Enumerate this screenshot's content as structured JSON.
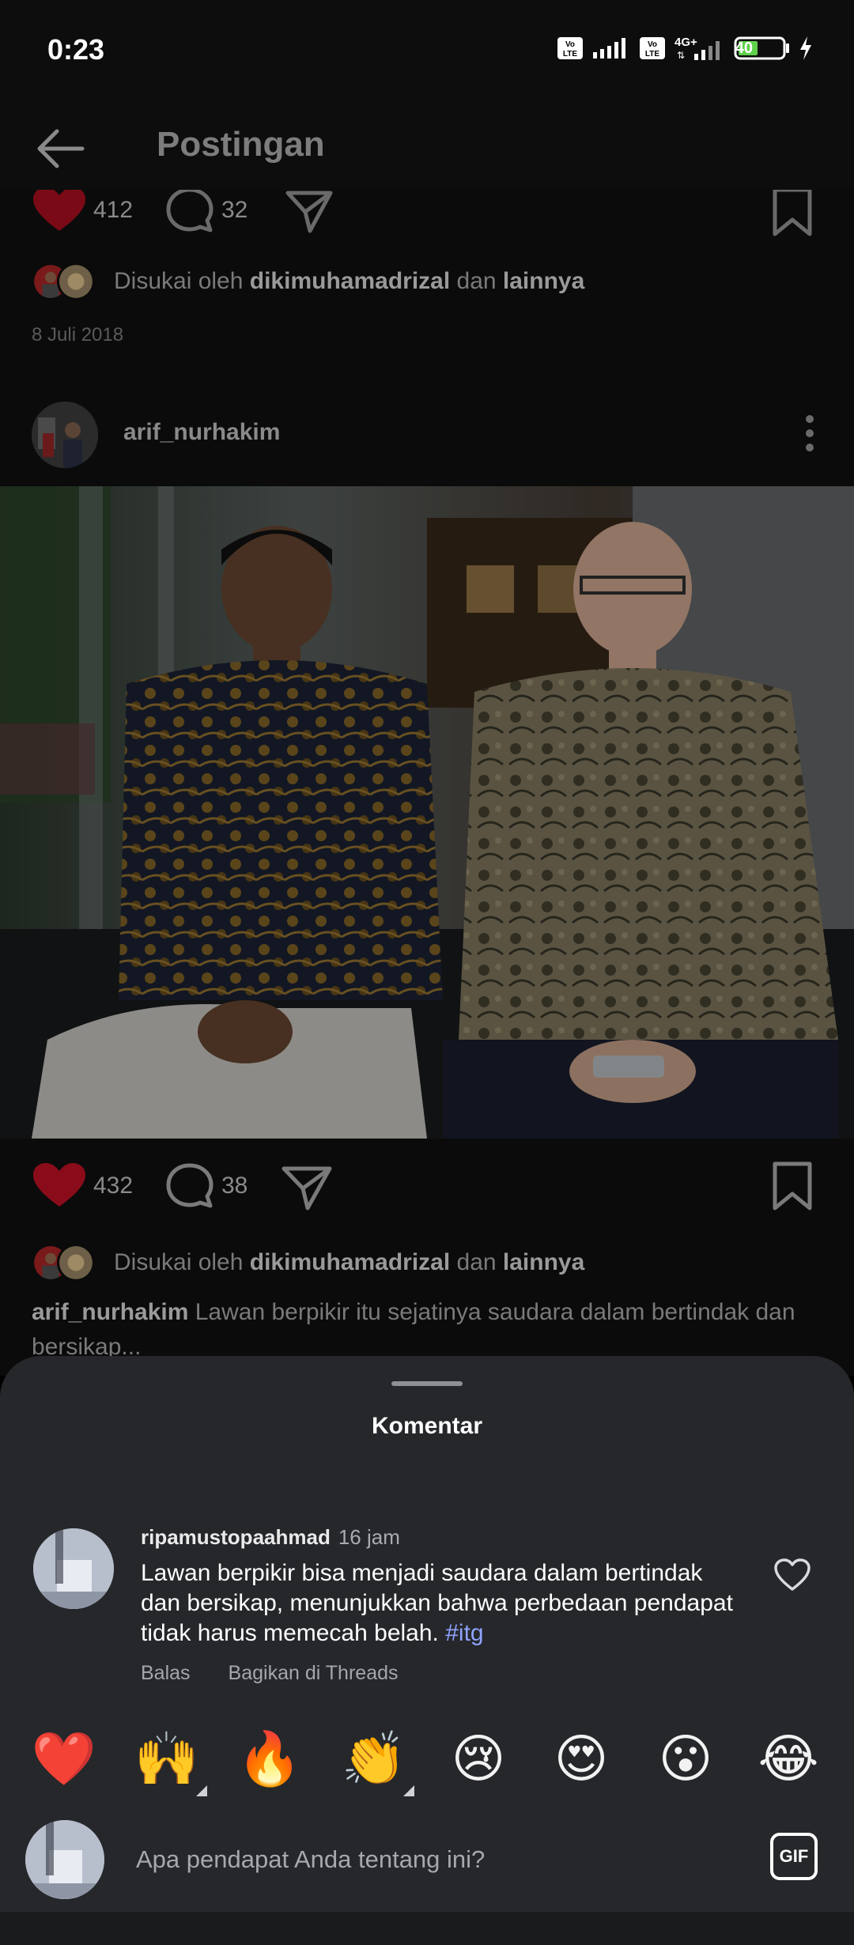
{
  "status": {
    "time": "0:23",
    "battery": "40"
  },
  "header": {
    "title": "Postingan"
  },
  "prev_post": {
    "like_count": "412",
    "comment_count": "32",
    "liked_by_prefix": "Disukai oleh ",
    "liked_by_user": "dikimuhamadrizal",
    "liked_by_middle": " dan ",
    "liked_by_suffix": "lainnya",
    "date": "8 Juli 2018"
  },
  "post": {
    "username": "arif_nurhakim",
    "like_count": "432",
    "comment_count": "38",
    "liked_by_prefix": "Disukai oleh ",
    "liked_by_user": "dikimuhamadrizal",
    "liked_by_middle": " dan ",
    "liked_by_suffix": "lainnya",
    "caption_user": "arif_nurhakim",
    "caption_text": " Lawan berpikir itu sejatinya saudara dalam bertindak dan bersikap..."
  },
  "comments_sheet": {
    "title": "Komentar",
    "comment": {
      "username": "ripamustopaahmad",
      "time": "16 jam",
      "text": "Lawan berpikir bisa menjadi saudara dalam bertindak dan bersikap, menunjukkan bahwa perbedaan pendapat tidak harus memecah belah. ",
      "hashtag": "#itg",
      "reply_label": "Balas",
      "share_label": "Bagikan di Threads"
    },
    "emojis": [
      "❤️",
      "🙌",
      "🔥",
      "👏",
      "😢",
      "😍",
      "😮",
      "😂"
    ],
    "input_placeholder": "Apa pendapat Anda tentang ini?",
    "gif_label": "GIF"
  },
  "colors": {
    "like_red": "#c8102e",
    "sheet_bg": "#25272a",
    "hashtag": "#8ea2ff"
  }
}
